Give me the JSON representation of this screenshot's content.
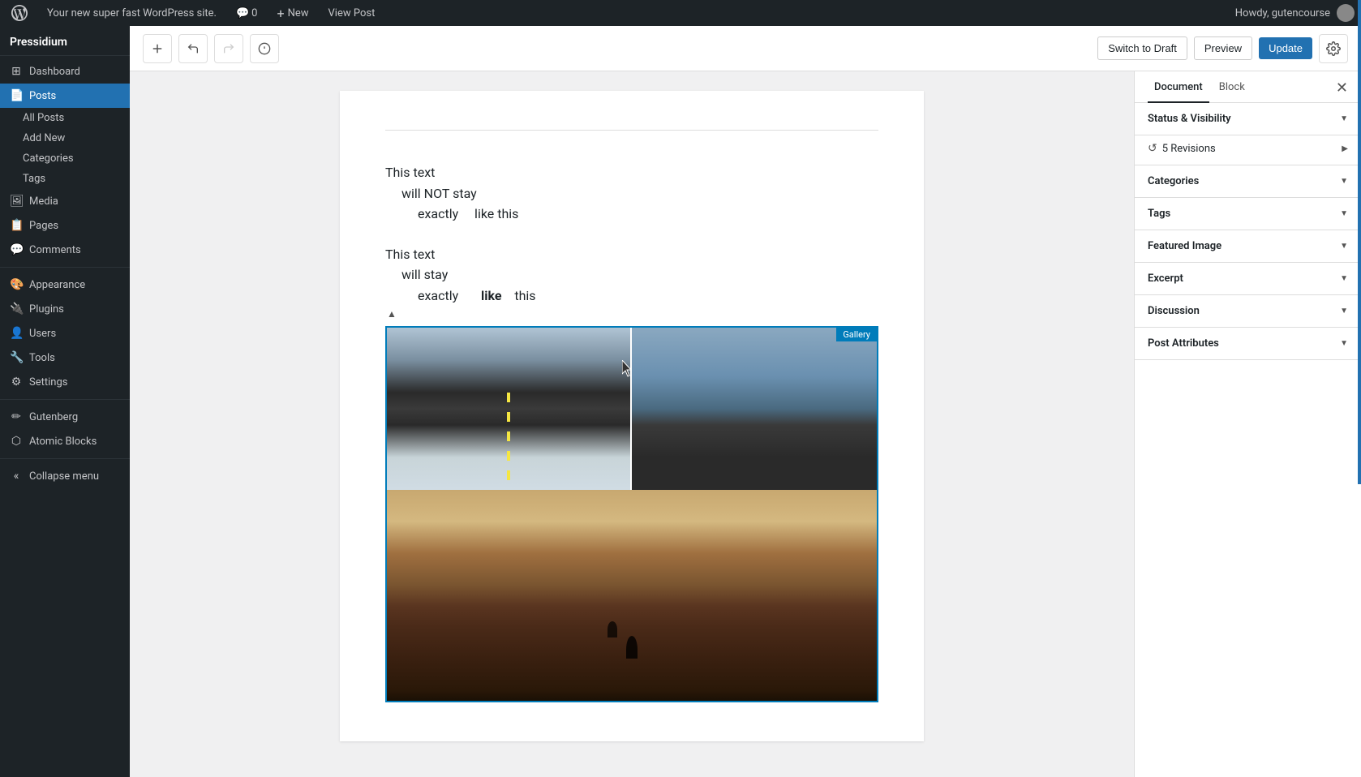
{
  "adminbar": {
    "logo_alt": "WordPress",
    "site_name": "Your new super fast WordPress site.",
    "comments_label": "Comments",
    "comments_count": "0",
    "new_label": "New",
    "view_post_label": "View Post",
    "howdy_label": "Howdy, gutencourse"
  },
  "sidebar": {
    "site_name": "Pressidium",
    "items": [
      {
        "id": "dashboard",
        "label": "Dashboard",
        "icon": "⊞"
      },
      {
        "id": "posts",
        "label": "Posts",
        "icon": "📄",
        "active": true
      },
      {
        "id": "media",
        "label": "Media",
        "icon": "🖼"
      },
      {
        "id": "pages",
        "label": "Pages",
        "icon": "📋"
      },
      {
        "id": "comments",
        "label": "Comments",
        "icon": "💬"
      },
      {
        "id": "appearance",
        "label": "Appearance",
        "icon": "🎨"
      },
      {
        "id": "plugins",
        "label": "Plugins",
        "icon": "🔌"
      },
      {
        "id": "users",
        "label": "Users",
        "icon": "👤"
      },
      {
        "id": "tools",
        "label": "Tools",
        "icon": "🔧"
      },
      {
        "id": "settings",
        "label": "Settings",
        "icon": "⚙"
      },
      {
        "id": "gutenberg",
        "label": "Gutenberg",
        "icon": "✏"
      },
      {
        "id": "atomic-blocks",
        "label": "Atomic Blocks",
        "icon": "⬡"
      },
      {
        "id": "collapse",
        "label": "Collapse menu",
        "icon": "«"
      }
    ],
    "posts_subitems": [
      {
        "label": "All Posts"
      },
      {
        "label": "Add New"
      },
      {
        "label": "Categories"
      },
      {
        "label": "Tags"
      }
    ]
  },
  "topbar": {
    "add_block_title": "Add block",
    "undo_title": "Undo",
    "redo_title": "Redo",
    "info_title": "Info",
    "switch_draft_label": "Switch to Draft",
    "preview_label": "Preview",
    "update_label": "Update",
    "settings_title": "Settings"
  },
  "editor": {
    "text_block_1": {
      "line1": "This text",
      "line2": "will NOT stay",
      "line3_part1": "exactly",
      "line3_part2": "like this"
    },
    "text_block_2": {
      "line1": "This text",
      "line2": "will stay",
      "line3_part1": "exactly",
      "line3_part2": "like",
      "line3_part3": "this"
    },
    "gallery_badge": "Gallery"
  },
  "right_panel": {
    "tab_document": "Document",
    "tab_block": "Block",
    "sections": [
      {
        "id": "status-visibility",
        "title": "Status & Visibility",
        "expanded": true
      },
      {
        "id": "revisions",
        "title": "5 Revisions",
        "is_revisions": true
      },
      {
        "id": "categories",
        "title": "Categories",
        "expanded": false
      },
      {
        "id": "tags",
        "title": "Tags",
        "expanded": false
      },
      {
        "id": "featured-image",
        "title": "Featured Image",
        "expanded": false
      },
      {
        "id": "excerpt",
        "title": "Excerpt",
        "expanded": false
      },
      {
        "id": "discussion",
        "title": "Discussion",
        "expanded": false
      },
      {
        "id": "post-attributes",
        "title": "Post Attributes",
        "expanded": false
      }
    ]
  }
}
